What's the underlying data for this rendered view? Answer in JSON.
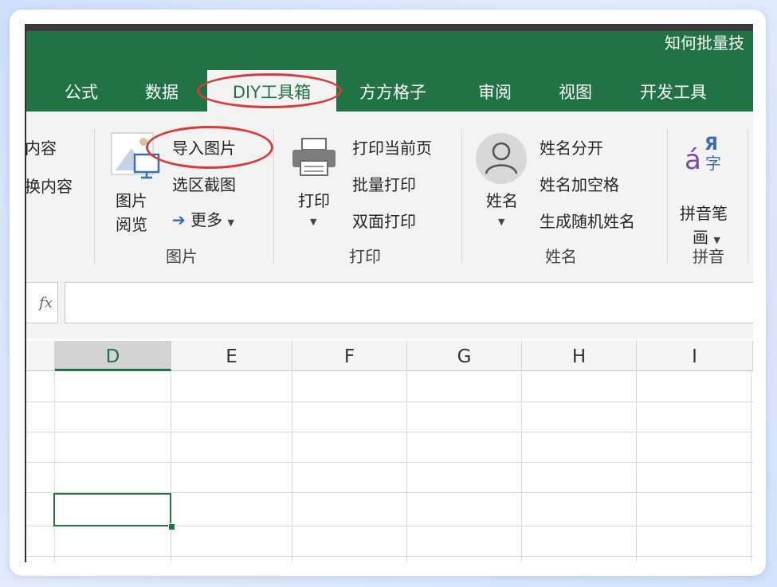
{
  "window": {
    "title": "知何批量技"
  },
  "tabs": [
    "公式",
    "数据",
    "DIY工具箱",
    "方方格子",
    "审阅",
    "视图",
    "开发工具"
  ],
  "ribbon": {
    "content_group": {
      "item1": "内容",
      "item2": "换内容"
    },
    "image_group": {
      "preview_label_line1": "图片",
      "preview_label_line2": "阅览",
      "import_image": "导入图片",
      "area_screenshot": "选区截图",
      "more": "更多",
      "group_label": "图片"
    },
    "print_group": {
      "print_label": "打印",
      "print_current": "打印当前页",
      "batch_print": "批量打印",
      "duplex_print": "双面打印",
      "group_label": "打印"
    },
    "name_group": {
      "name_label": "姓名",
      "split_name": "姓名分开",
      "name_spacing": "姓名加空格",
      "random_name": "生成随机姓名",
      "group_label": "姓名"
    },
    "pinyin_group": {
      "stroke_line1": "拼音笔",
      "stroke_line2": "画",
      "group_label": "拼音"
    }
  },
  "formula_bar": {
    "fx": "fx",
    "value": ""
  },
  "columns": [
    "D",
    "E",
    "F",
    "G",
    "H",
    "I"
  ],
  "selected_column": "D",
  "colors": {
    "excel_green": "#217346",
    "highlight_oval": "#d93b3b"
  }
}
